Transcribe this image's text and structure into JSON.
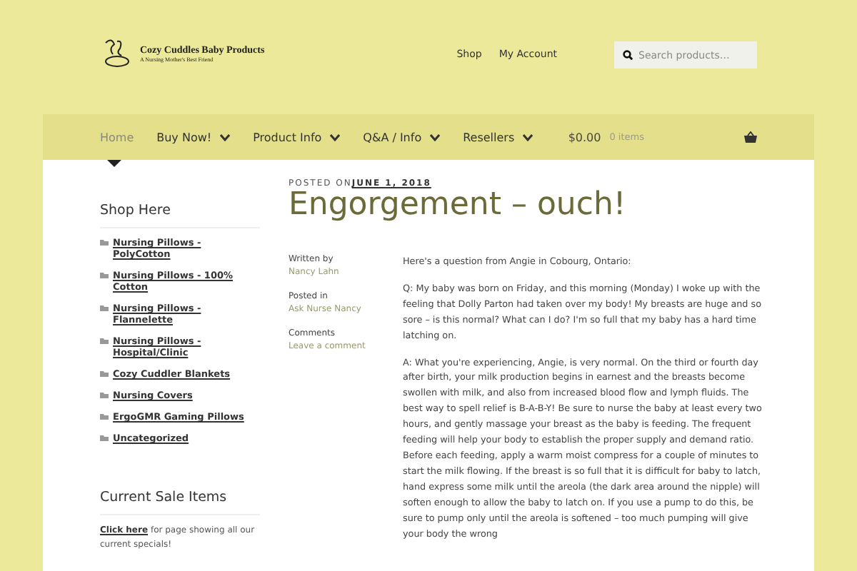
{
  "header": {
    "logo_title": "Cozy Cuddles Baby Products",
    "logo_tagline": "A Nursing Mother's Best Friend",
    "links": [
      "Shop",
      "My Account"
    ],
    "search": {
      "placeholder": "Search products…"
    }
  },
  "nav": {
    "items": [
      {
        "label": "Home",
        "selected": true,
        "dropdown": false
      },
      {
        "label": "Buy Now!",
        "selected": false,
        "dropdown": true
      },
      {
        "label": "Product Info",
        "selected": false,
        "dropdown": true
      },
      {
        "label": "Q&A / Info",
        "selected": false,
        "dropdown": true
      },
      {
        "label": "Resellers",
        "selected": false,
        "dropdown": true
      }
    ],
    "cart": {
      "total": "$0.00",
      "count": "0 items"
    }
  },
  "sidebar": {
    "shop_title": "Shop Here",
    "categories": [
      "Nursing Pillows - PolyCotton",
      "Nursing Pillows - 100% Cotton",
      "Nursing Pillows - Flannelette",
      "Nursing Pillows - Hospital/Clinic",
      "Cozy Cuddler Blankets",
      "Nursing Covers",
      "ErgoGMR Gaming Pillows",
      "Uncategorized"
    ],
    "sale_title": "Current Sale Items",
    "sale_link": "Click here",
    "sale_text": "for page showing all our current specials!"
  },
  "post": {
    "posted_label": "POSTED ON",
    "date": "JUNE 1, 2018",
    "title": "Engorgement – ouch!",
    "meta": [
      {
        "label": "Written by",
        "value": "Nancy Lahn"
      },
      {
        "label": "Posted in",
        "value": "Ask Nurse Nancy"
      },
      {
        "label": "Comments",
        "value": "Leave a comment"
      }
    ],
    "paragraphs": [
      "Here's a question from Angie in Cobourg, Ontario:",
      "Q: My baby was born on Friday, and this morning (Monday) I woke up with the feeling that Dolly Parton had taken over my body! My breasts are huge and so sore – is this normal? What can I do? I'm so full that my baby has a hard time latching on.",
      "A: What you're experiencing, Angie, is very normal. On the third or fourth day after birth, your milk production begins in earnest and the breasts become swollen with milk, and also from increased blood flow and lymph fluids. The best way to spell relief is B-A-B-Y! Be sure to nurse the baby at least every two hours, and gently massage your breast as the baby is feeding. The frequent feeding will help your body to establish the proper supply and demand ratio. Before each feeding, apply a warm moist compress for a couple of minutes to start the milk flowing. If the breast is so full that it is difficult for baby to latch, hand express some milk until the areola (the dark area around the nipple) will soften enough to allow the baby to latch on. If you use a pump to do this, be sure to pump only until the areola is softened – too much pumping will give your body the wrong"
    ]
  }
}
